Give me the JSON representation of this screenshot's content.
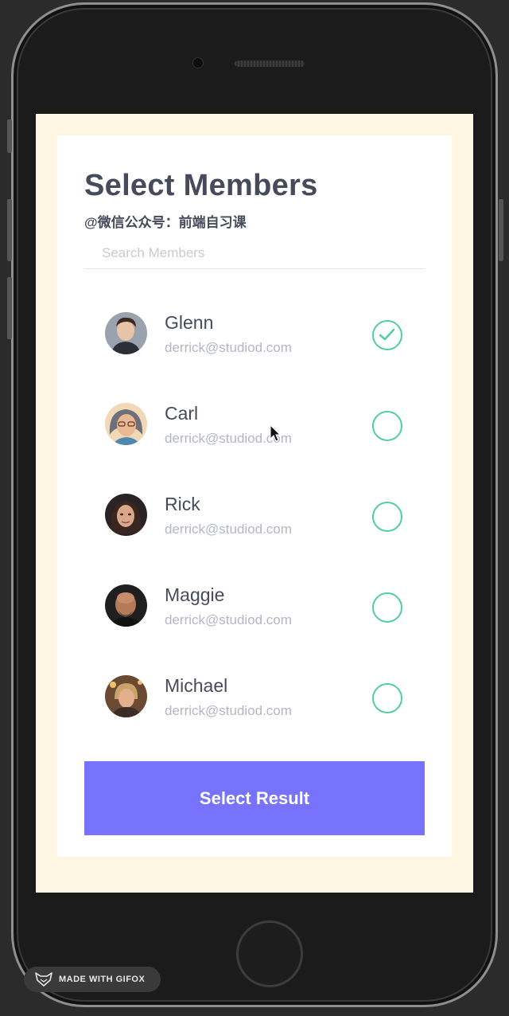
{
  "header": {
    "title": "Select Members",
    "subtitle": "@微信公众号：前端自习课"
  },
  "search": {
    "placeholder": "Search Members",
    "value": ""
  },
  "members": [
    {
      "name": "Glenn",
      "email": "derrick@studiod.com",
      "selected": true
    },
    {
      "name": "Carl",
      "email": "derrick@studiod.com",
      "selected": false
    },
    {
      "name": "Rick",
      "email": "derrick@studiod.com",
      "selected": false
    },
    {
      "name": "Maggie",
      "email": "derrick@studiod.com",
      "selected": false
    },
    {
      "name": "Michael",
      "email": "derrick@studiod.com",
      "selected": false
    }
  ],
  "action": {
    "label": "Select Result"
  },
  "watermark": {
    "label": "MADE WITH GIFOX"
  },
  "colors": {
    "accent": "#7773ff",
    "check": "#4fce9f",
    "title": "#474a5a",
    "frame": "#fdf6e3"
  }
}
